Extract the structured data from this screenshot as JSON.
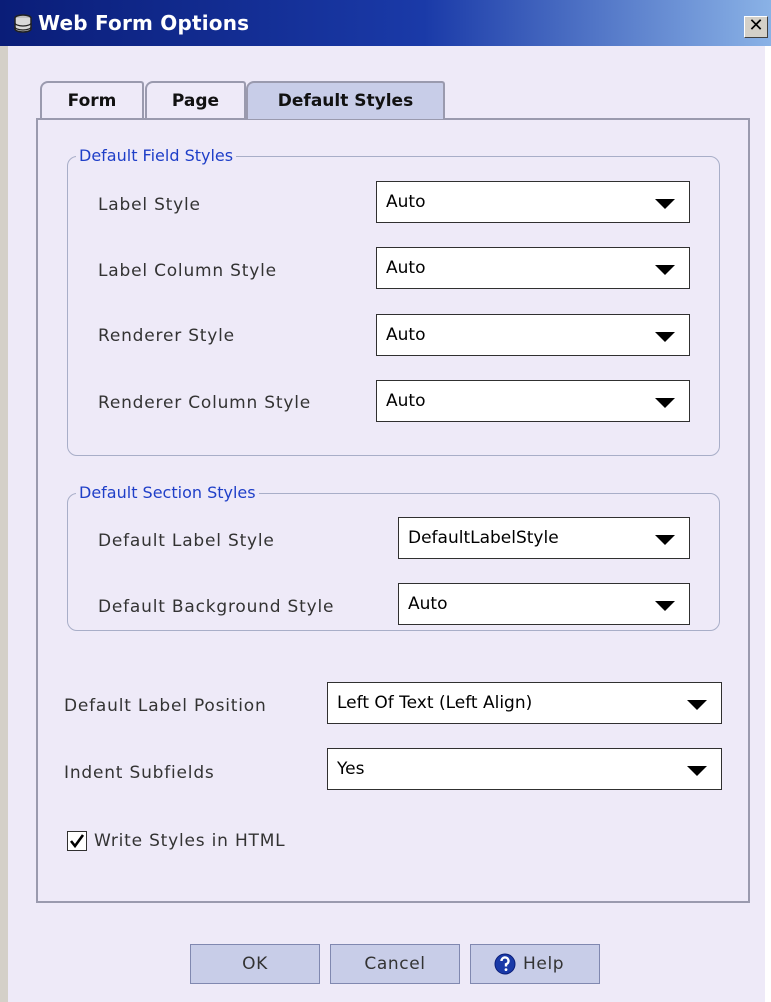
{
  "window": {
    "title": "Web Form Options",
    "close_label": "✕"
  },
  "tabs": [
    {
      "label": "Form"
    },
    {
      "label": "Page"
    },
    {
      "label": "Default Styles"
    }
  ],
  "field_styles": {
    "legend": "Default Field Styles",
    "rows": [
      {
        "label": "Label Style",
        "value": "Auto"
      },
      {
        "label": "Label Column Style",
        "value": "Auto"
      },
      {
        "label": "Renderer Style",
        "value": "Auto"
      },
      {
        "label": "Renderer Column Style",
        "value": "Auto"
      }
    ]
  },
  "section_styles": {
    "legend": "Default Section Styles",
    "rows": [
      {
        "label": "Default Label Style",
        "value": "DefaultLabelStyle"
      },
      {
        "label": "Default Background Style",
        "value": "Auto"
      }
    ]
  },
  "general": {
    "label_position": {
      "label": "Default Label Position",
      "value": "Left Of Text (Left Align)"
    },
    "indent_subfields": {
      "label": "Indent Subfields",
      "value": "Yes"
    }
  },
  "write_styles": {
    "label": "Write Styles in HTML",
    "checked": true
  },
  "buttons": {
    "ok": "OK",
    "cancel": "Cancel",
    "help": "Help"
  },
  "colors": {
    "accent": "#1f3fc8",
    "title_bar": "#0a1d78",
    "button_bg": "#c8cde8"
  }
}
